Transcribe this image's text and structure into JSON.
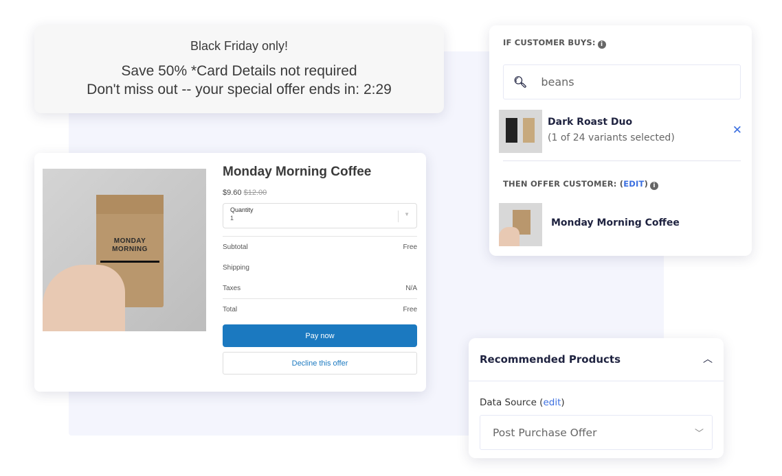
{
  "banner": {
    "line1": "Black Friday only!",
    "line2": "Save 50% *Card Details not required",
    "line3": "Don't miss out -- your special offer ends in: 2:29"
  },
  "checkout": {
    "product_image_text": "MONDAY MORNING",
    "title": "Monday Morning Coffee",
    "price": "$9.60",
    "compare_price": "$12.00",
    "quantity_label": "Quantity",
    "quantity_value": "1",
    "rows": [
      {
        "label": "Subtotal",
        "value": "Free"
      },
      {
        "label": "Shipping",
        "value": ""
      },
      {
        "label": "Taxes",
        "value": "N/A"
      }
    ],
    "total": {
      "label": "Total",
      "value": "Free"
    },
    "pay_label": "Pay now",
    "decline_label": "Decline this offer",
    "accent": "#1b79c0"
  },
  "rule": {
    "if_header": "IF CUSTOMER BUYS:",
    "search_value": "beans",
    "selected": {
      "name": "Dark Roast Duo",
      "variants": "(1 of 24 variants selected)"
    },
    "then_header": "THEN OFFER CUSTOMER: (",
    "then_edit": "EDIT",
    "then_close": ")",
    "offer": {
      "name": "Monday Morning Coffee"
    },
    "link_color": "#3b6fe0"
  },
  "recommended": {
    "title": "Recommended Products",
    "data_source_label": "Data Source (",
    "edit": "edit",
    "close_paren": ")",
    "select_value": "Post Purchase Offer"
  }
}
